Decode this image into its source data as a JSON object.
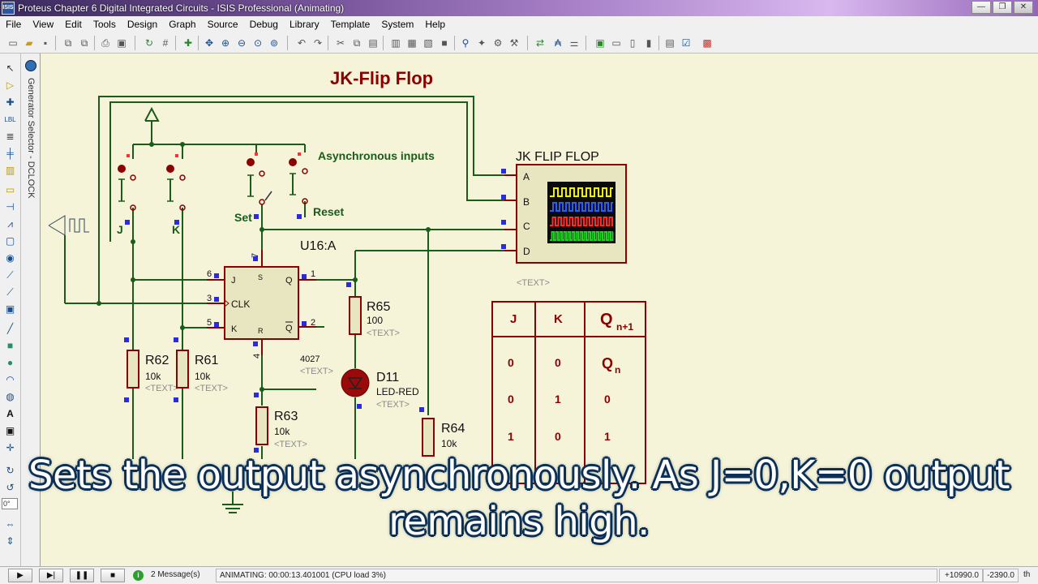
{
  "window": {
    "app_icon_text": "ISIS",
    "title": "Proteus Chapter 6 Digital Integrated Circuits - ISIS Professional (Animating)",
    "buttons": [
      "—",
      "❐",
      "✕"
    ]
  },
  "menu": [
    "File",
    "View",
    "Edit",
    "Tools",
    "Design",
    "Graph",
    "Source",
    "Debug",
    "Library",
    "Template",
    "System",
    "Help"
  ],
  "selector": {
    "label": "Generator Selector - DCLOCK"
  },
  "left_tools": {
    "rotation_value": "0°"
  },
  "schematic": {
    "title": "JK-Flip Flop",
    "async_label": "Asynchronous inputs",
    "switch_labels": {
      "j": "J",
      "k": "K",
      "set": "Set",
      "reset": "Reset"
    },
    "ic": {
      "ref": "U16:A",
      "part": "4027",
      "text": "<TEXT>",
      "pins": {
        "j": "J",
        "clk": "CLK",
        "k": "K",
        "s": "S",
        "r": "R",
        "q": "Q",
        "qbar": "Q"
      },
      "pin_numbers": {
        "j": "6",
        "clk": "3",
        "k": "5",
        "s": "7",
        "r": "4",
        "q": "1",
        "qbar": "2"
      }
    },
    "resistors": [
      {
        "ref": "R62",
        "value": "10k",
        "text": "<TEXT>"
      },
      {
        "ref": "R61",
        "value": "10k",
        "text": "<TEXT>"
      },
      {
        "ref": "R63",
        "value": "10k",
        "text": "<TEXT>"
      },
      {
        "ref": "R65",
        "value": "100",
        "text": "<TEXT>"
      },
      {
        "ref": "R64",
        "value": "10k",
        "text": "<TEXT>"
      }
    ],
    "led": {
      "ref": "D11",
      "value": "LED-RED",
      "text": "<TEXT>"
    },
    "scope": {
      "title": "JK FLIP FLOP",
      "channels": [
        "A",
        "B",
        "C",
        "D"
      ],
      "text": "<TEXT>",
      "trace_colors": [
        "#f2f200",
        "#2060ff",
        "#ff2a2a",
        "#20d020"
      ]
    },
    "truth_table": {
      "headers": [
        "J",
        "K",
        "Q",
        "n+1"
      ],
      "rows": [
        [
          "0",
          "0",
          "Q",
          "n"
        ],
        [
          "0",
          "1",
          "0"
        ],
        [
          "1",
          "0",
          "1"
        ]
      ]
    }
  },
  "subtitle": [
    "Sets the output asynchronously. As J=0,K=0 output",
    "remains high."
  ],
  "status": {
    "messages": "2 Message(s)",
    "animating": "ANIMATING: 00:00:13.401001 (CPU load 3%)",
    "coord_x": "+10990.0",
    "coord_y": "-2390.0",
    "units": "th"
  },
  "colors": {
    "wire": "#1a5c1a",
    "label_red": "#8b0000",
    "canvas": "#f5f3d8",
    "pin_blue": "#2b2bde"
  }
}
